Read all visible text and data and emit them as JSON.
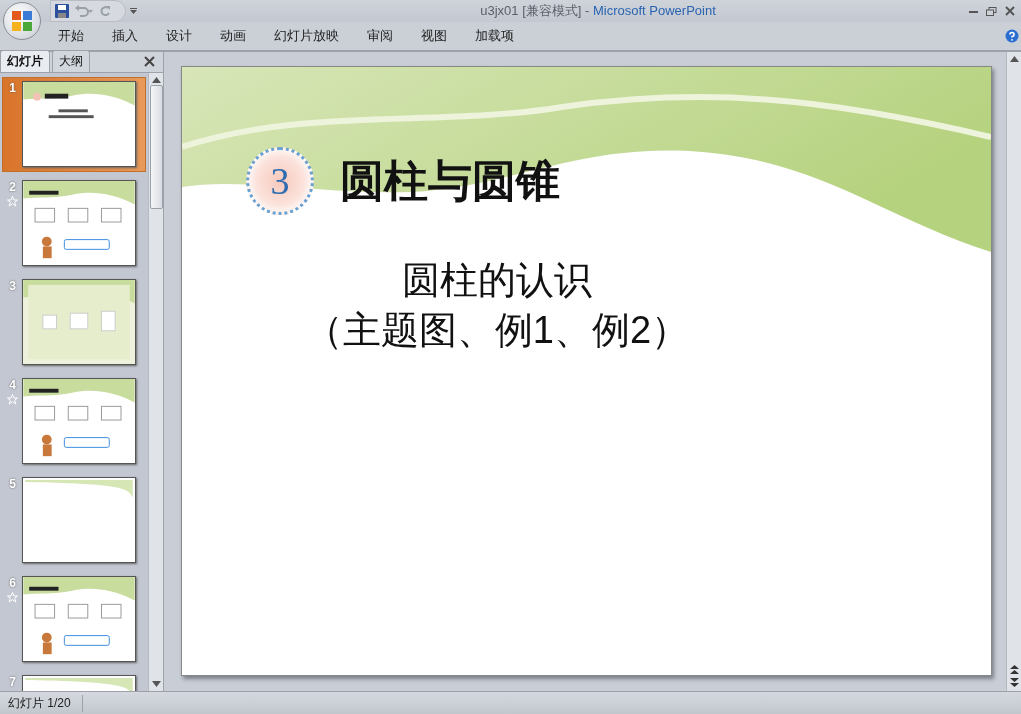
{
  "window": {
    "document_title": "u3jx01 [兼容模式] - ",
    "app_name": "Microsoft PowerPoint"
  },
  "ribbon_tabs": [
    {
      "label": "开始",
      "selected": false
    },
    {
      "label": "插入",
      "selected": false
    },
    {
      "label": "设计",
      "selected": false
    },
    {
      "label": "动画",
      "selected": false
    },
    {
      "label": "幻灯片放映",
      "selected": false
    },
    {
      "label": "审阅",
      "selected": false
    },
    {
      "label": "视图",
      "selected": false
    },
    {
      "label": "加载项",
      "selected": false
    }
  ],
  "pane_tabs": [
    {
      "label": "幻灯片",
      "selected": true
    },
    {
      "label": "大纲",
      "selected": false
    }
  ],
  "slides": [
    {
      "number": "1",
      "selected": true,
      "animated": false,
      "kind": "title"
    },
    {
      "number": "2",
      "selected": false,
      "animated": true,
      "kind": "content"
    },
    {
      "number": "3",
      "selected": false,
      "animated": false,
      "kind": "tinted"
    },
    {
      "number": "4",
      "selected": false,
      "animated": true,
      "kind": "content"
    },
    {
      "number": "5",
      "selected": false,
      "animated": false,
      "kind": "blank"
    },
    {
      "number": "6",
      "selected": false,
      "animated": true,
      "kind": "content"
    },
    {
      "number": "7",
      "selected": false,
      "animated": false,
      "kind": "blank"
    }
  ],
  "slide": {
    "badge": "3",
    "title": "圆柱与圆锥",
    "subtitle_lines": [
      "圆柱的认识",
      "（主题图、例1、例2）"
    ]
  },
  "status_bar": {
    "slide_counter": "幻灯片 1/20"
  }
}
